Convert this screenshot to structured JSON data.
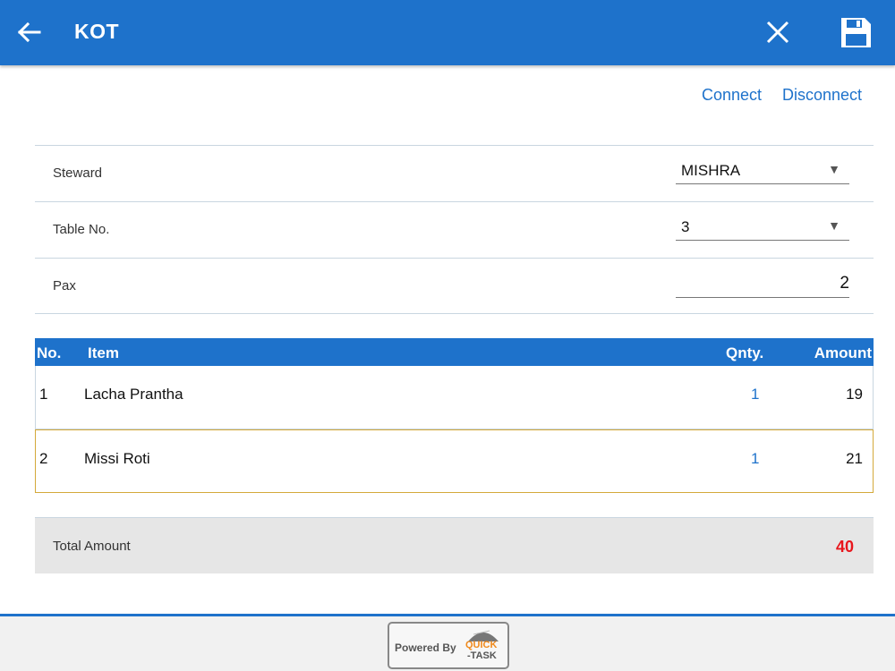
{
  "header": {
    "title": "KOT",
    "back_icon": "arrow-left-icon",
    "close_icon": "close-icon",
    "save_icon": "save-icon",
    "bg_color": "#1e72cb"
  },
  "links": {
    "connect": "Connect",
    "disconnect": "Disconnect"
  },
  "form": {
    "steward_label": "Steward",
    "steward_value": "MISHRA",
    "table_label": "Table No.",
    "table_value": "3",
    "pax_label": "Pax",
    "pax_value": "2"
  },
  "table": {
    "columns": [
      "No.",
      "Item",
      "Qnty.",
      "Amount"
    ],
    "rows": [
      {
        "no": "1",
        "item": "Lacha Prantha",
        "qty": "1",
        "amount": "19"
      },
      {
        "no": "2",
        "item": "Missi Roti",
        "qty": "1",
        "amount": "21"
      }
    ]
  },
  "total": {
    "label": "Total Amount",
    "value": "40",
    "value_color": "#e8161c"
  },
  "footer": {
    "powered_by": "Powered By",
    "logo_line1": "QUICK",
    "logo_line2": "-TASK"
  }
}
